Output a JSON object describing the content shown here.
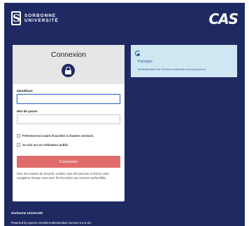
{
  "header": {
    "brand_line1": "SORBONNE",
    "brand_line2": "UNIVERSITÉ",
    "brand_mark": "S",
    "cas_logo": "CAS"
  },
  "login": {
    "title": "Connexion",
    "lock_icon": "lock-icon",
    "username_label": "Identifiant:",
    "username_value": "",
    "password_label": "Mot de passe:",
    "password_value": "",
    "warn_label": "Prévenez-moi avant d'accéder à d'autres services.",
    "warn_checked": false,
    "public_label": "Je suis sur un ordinateur public.",
    "public_checked": false,
    "submit_label": "Connexion",
    "security_note": "Pour des raisons de sécurité, veuillez vous déconnecter et fermer votre navigateur lorsque vous avez fini d'accéder aux services authentifiés."
  },
  "service": {
    "icon": "panopto-icon",
    "name": "Panopto",
    "description": "Authentification sur sorbonne-universite.cloud.panopto.eu"
  },
  "footer": {
    "org": "Sorbonne Université",
    "powered": "Powered by Apereo Central Authentication Service 5.2.6-SU"
  },
  "colors": {
    "background": "#1f2a63",
    "button": "#e06b6b",
    "service_card": "#cfe6f3",
    "focus_border": "#3d6fd6"
  }
}
